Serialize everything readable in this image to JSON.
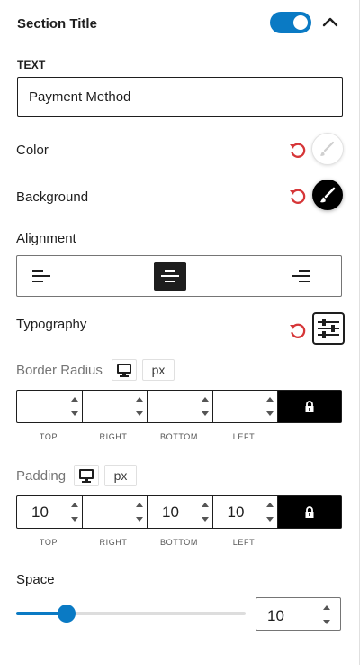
{
  "panel": {
    "title": "Section Title",
    "enabled": true
  },
  "text": {
    "label": "TEXT",
    "value": "Payment Method"
  },
  "color": {
    "label": "Color",
    "swatch": "#ffffff"
  },
  "background": {
    "label": "Background",
    "swatch": "#000000"
  },
  "alignment": {
    "label": "Alignment",
    "options": [
      "left",
      "center",
      "right"
    ],
    "selected": "center"
  },
  "typography": {
    "label": "Typography"
  },
  "border_radius": {
    "label": "Border Radius",
    "unit": "px",
    "values": [
      "",
      "",
      "",
      ""
    ],
    "sides": [
      "TOP",
      "RIGHT",
      "BOTTOM",
      "LEFT"
    ]
  },
  "padding": {
    "label": "Padding",
    "unit": "px",
    "values": [
      "10",
      "",
      "10",
      "10"
    ],
    "sides": [
      "TOP",
      "RIGHT",
      "BOTTOM",
      "LEFT"
    ]
  },
  "space": {
    "label": "Space",
    "value": "10",
    "slider_fraction": 0.22
  },
  "colors": {
    "accent": "#0a7ac4",
    "reset": "#d63638",
    "text": "#1e1e1e",
    "muted": "#757575"
  },
  "icons": [
    "chevron-up-icon",
    "reset-icon",
    "brush-icon",
    "align-left-icon",
    "align-center-icon",
    "align-right-icon",
    "sliders-icon",
    "desktop-icon",
    "lock-icon",
    "spinner-arrows-icon"
  ]
}
